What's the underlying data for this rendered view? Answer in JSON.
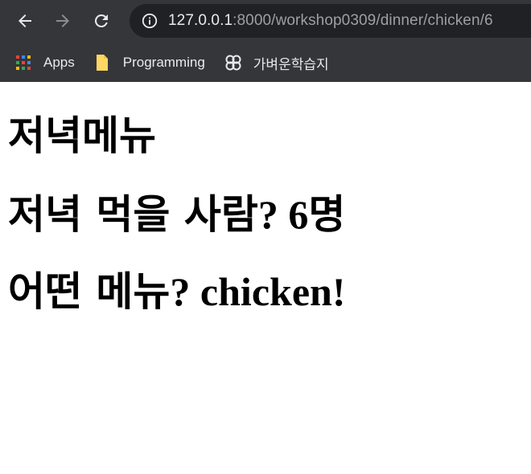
{
  "browser": {
    "url_host": "127.0.0.1",
    "url_path": ":8000/workshop0309/dinner/chicken/6",
    "bookmarks": [
      {
        "label": "Apps",
        "icon": "apps-grid-icon"
      },
      {
        "label": "Programming",
        "icon": "folder-icon"
      },
      {
        "label": "가벼운학습지",
        "icon": "site-favicon-icon"
      }
    ]
  },
  "page": {
    "title": "저녁메뉴",
    "people_prefix": "저녁 먹을 사람",
    "people_suffix": "? 6",
    "people_unit": "명",
    "menu_prefix": "어떤 메뉴",
    "menu_suffix": "? chicken!"
  },
  "colors": {
    "chrome_bg": "#35363a",
    "omnibox_bg": "#202124",
    "url_host": "#e8eaed",
    "url_path": "#9aa0a6"
  }
}
